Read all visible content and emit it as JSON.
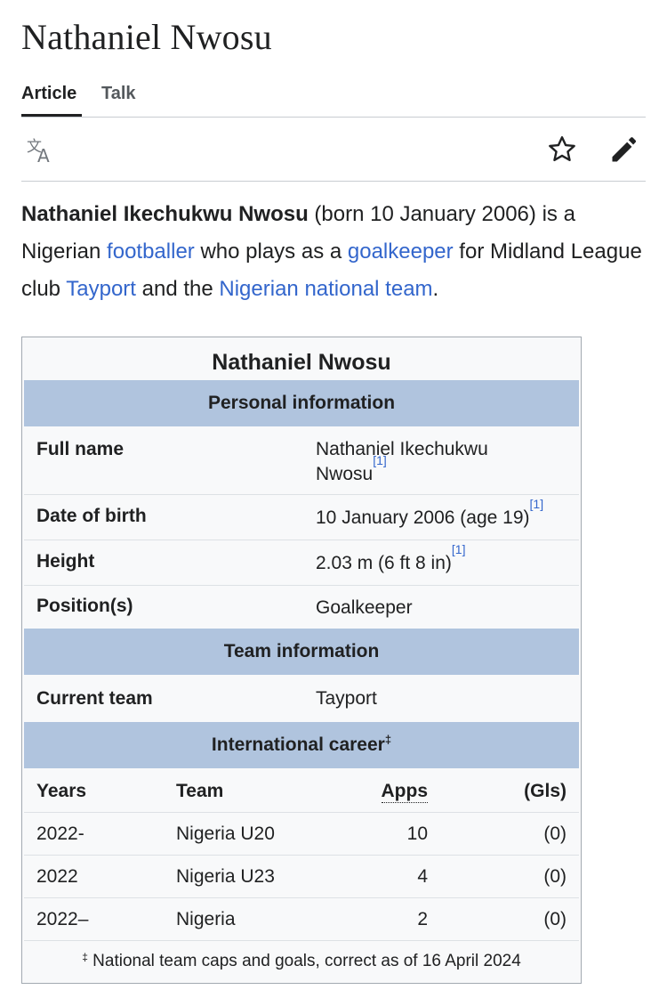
{
  "page": {
    "title": "Nathaniel Nwosu",
    "tabs": [
      "Article",
      "Talk"
    ]
  },
  "toolbar": {
    "icons": [
      "language-icon",
      "star-icon",
      "pencil-icon"
    ]
  },
  "lead": {
    "name_bold": "Nathaniel Ikechukwu Nwosu",
    "text1": " (born 10 January 2006) is a Nigerian ",
    "link1": "footballer",
    "text2": " who plays as a ",
    "link2": "goalkeeper",
    "text3": " for Midland League club ",
    "link3": "Tayport",
    "text4": " and the ",
    "link4": "Nigerian national team",
    "text5": "."
  },
  "infobox": {
    "title": "Nathaniel Nwosu",
    "personal_header": "Personal information",
    "rows": {
      "full_name": {
        "label": "Full name",
        "value_line1": "Nathaniel Ikechukwu",
        "value_line2": "Nwosu",
        "ref": "[1]"
      },
      "dob": {
        "label": "Date of birth",
        "value": "10 January 2006 (age 19)",
        "ref": "[1]"
      },
      "height": {
        "label": "Height",
        "value": "2.03 m (6 ft 8 in)",
        "ref": "[1]"
      },
      "position": {
        "label": "Position(s)",
        "value": "Goalkeeper"
      }
    },
    "team_header": "Team information",
    "current_team": {
      "label": "Current team",
      "value": "Tayport"
    },
    "intl_header": "International career",
    "intl_header_mark": "‡",
    "intl_columns": [
      "Years",
      "Team",
      "Apps",
      "(Gls)"
    ],
    "intl_rows": [
      {
        "years": "2022-",
        "team": "Nigeria U20",
        "apps": "10",
        "gls": "(0)"
      },
      {
        "years": "2022",
        "team": "Nigeria U23",
        "apps": "4",
        "gls": "(0)"
      },
      {
        "years": "2022–",
        "team": "Nigeria",
        "apps": "2",
        "gls": "(0)"
      }
    ],
    "footer_mark": "‡",
    "footer_text": " National team caps and goals, correct as of 16 April 2024"
  },
  "colors": {
    "link": "#3366cc",
    "header_bg": "#b0c4de",
    "infobox_bg": "#f8f9fa",
    "text": "#202122"
  }
}
